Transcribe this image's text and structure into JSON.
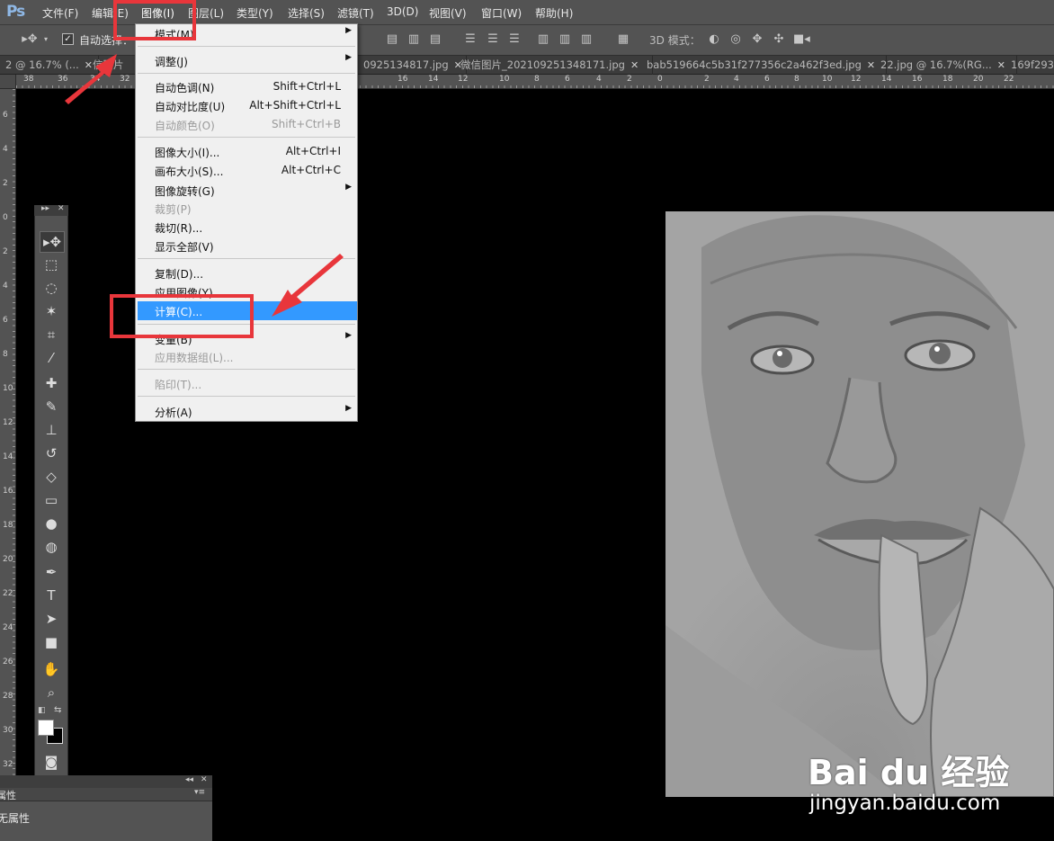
{
  "app": {
    "logo": "Ps"
  },
  "menubar": {
    "items": [
      "文件(F)",
      "编辑(E)",
      "图像(I)",
      "图层(L)",
      "类型(Y)",
      "选择(S)",
      "滤镜(T)",
      "3D(D)",
      "视图(V)",
      "窗口(W)",
      "帮助(H)"
    ],
    "active": "图像(I)"
  },
  "options_bar": {
    "auto_select_checked": true,
    "auto_select_label": "自动选择：",
    "mode_3d_label": "3D 模式："
  },
  "tabs": [
    "2 @ 16.7% (...",
    "信图片",
    "0925134817.jpg",
    "微信图片_20210925134817​1.jpg",
    "bab519664c5b31f277356c2a462f3ed.jpg",
    "22.jpg @ 16.7%(RG...",
    "169f293"
  ],
  "ruler_top_labels": [
    "38",
    "36",
    "34",
    "32",
    "16",
    "14",
    "12",
    "10",
    "8",
    "6",
    "4",
    "2",
    "0",
    "2",
    "4",
    "6",
    "8",
    "10",
    "12",
    "14",
    "16",
    "18",
    "20",
    "22"
  ],
  "ruler_left_labels": [
    "6",
    "4",
    "2",
    "0",
    "2",
    "4",
    "6",
    "8",
    "10",
    "12",
    "14",
    "16",
    "18",
    "20",
    "22",
    "24",
    "26",
    "28",
    "30",
    "32"
  ],
  "image_menu": {
    "items": [
      {
        "label": "模式(M)",
        "shortcut": "",
        "submenu": true,
        "disabled": false,
        "highlighted": false
      },
      {
        "label": "调整(J)",
        "shortcut": "",
        "submenu": true,
        "disabled": false,
        "highlighted": false
      },
      {
        "label": "自动色调(N)",
        "shortcut": "Shift+Ctrl+L",
        "submenu": false,
        "disabled": false,
        "highlighted": false
      },
      {
        "label": "自动对比度(U)",
        "shortcut": "Alt+Shift+Ctrl+L",
        "submenu": false,
        "disabled": false,
        "highlighted": false
      },
      {
        "label": "自动颜色(O)",
        "shortcut": "Shift+Ctrl+B",
        "submenu": false,
        "disabled": true,
        "highlighted": false
      },
      {
        "label": "图像大小(I)...",
        "shortcut": "Alt+Ctrl+I",
        "submenu": false,
        "disabled": false,
        "highlighted": false
      },
      {
        "label": "画布大小(S)...",
        "shortcut": "Alt+Ctrl+C",
        "submenu": false,
        "disabled": false,
        "highlighted": false
      },
      {
        "label": "图像旋转(G)",
        "shortcut": "",
        "submenu": true,
        "disabled": false,
        "highlighted": false
      },
      {
        "label": "裁剪(P)",
        "shortcut": "",
        "submenu": false,
        "disabled": true,
        "highlighted": false
      },
      {
        "label": "裁切(R)...",
        "shortcut": "",
        "submenu": false,
        "disabled": false,
        "highlighted": false
      },
      {
        "label": "显示全部(V)",
        "shortcut": "",
        "submenu": false,
        "disabled": false,
        "highlighted": false
      },
      {
        "label": "复制(D)...",
        "shortcut": "",
        "submenu": false,
        "disabled": false,
        "highlighted": false
      },
      {
        "label": "应用图像(Y)...",
        "shortcut": "",
        "submenu": false,
        "disabled": false,
        "highlighted": false
      },
      {
        "label": "计算(C)...",
        "shortcut": "",
        "submenu": false,
        "disabled": false,
        "highlighted": true
      },
      {
        "label": "变量(B)",
        "shortcut": "",
        "submenu": true,
        "disabled": false,
        "highlighted": false
      },
      {
        "label": "应用数据组(L)...",
        "shortcut": "",
        "submenu": false,
        "disabled": true,
        "highlighted": false
      },
      {
        "label": "陷印(T)...",
        "shortcut": "",
        "submenu": false,
        "disabled": true,
        "highlighted": false
      },
      {
        "label": "分析(A)",
        "shortcut": "",
        "submenu": true,
        "disabled": false,
        "highlighted": false
      }
    ]
  },
  "properties_panel": {
    "tab_label": "属性",
    "content": "无属性"
  },
  "watermark": {
    "brand": "Bai du 经验",
    "url": "jingyan.baidu.com"
  },
  "colors": {
    "highlight": "#3399ff",
    "annotation_red": "#e8363b",
    "ui_gray": "#535353"
  }
}
